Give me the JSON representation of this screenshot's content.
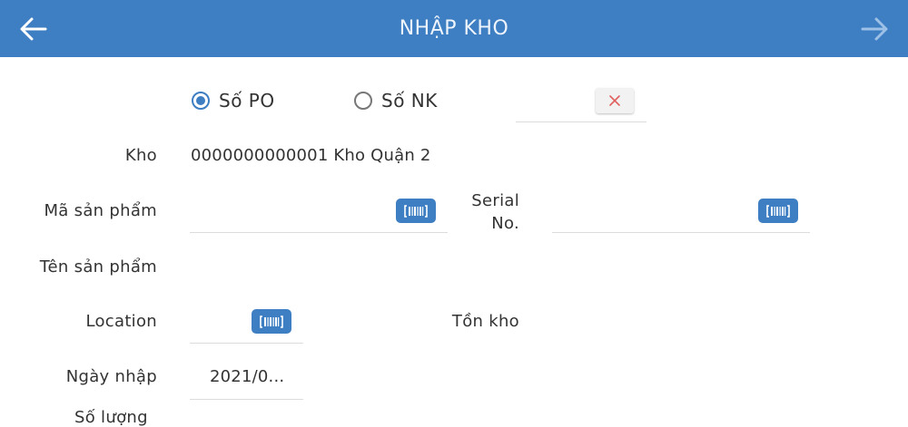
{
  "header": {
    "title": "NHẬP KHO",
    "back_icon": "arrow-left-icon",
    "forward_icon": "arrow-right-icon"
  },
  "mode": {
    "options": [
      {
        "label": "Số PO",
        "checked": true
      },
      {
        "label": "Số NK",
        "checked": false
      }
    ],
    "clear_icon": "close-icon"
  },
  "form": {
    "kho_label": "Kho",
    "kho_value": "0000000000001 Kho Quận 2",
    "ma_sp_label": "Mã sản phẩm",
    "serial_label_line1": "Serial",
    "serial_label_line2": "No.",
    "ten_sp_label": "Tên sản phẩm",
    "location_label": "Location",
    "ton_kho_label": "Tồn kho",
    "ngay_nhap_label": "Ngày nhập",
    "ngay_nhap_value": "2021/0...",
    "next_label": "Số lượng",
    "scan_icon": "barcode-icon"
  },
  "colors": {
    "primary": "#3e7ec2",
    "header_text": "#eef4fb",
    "clear_x": "#e06060"
  }
}
